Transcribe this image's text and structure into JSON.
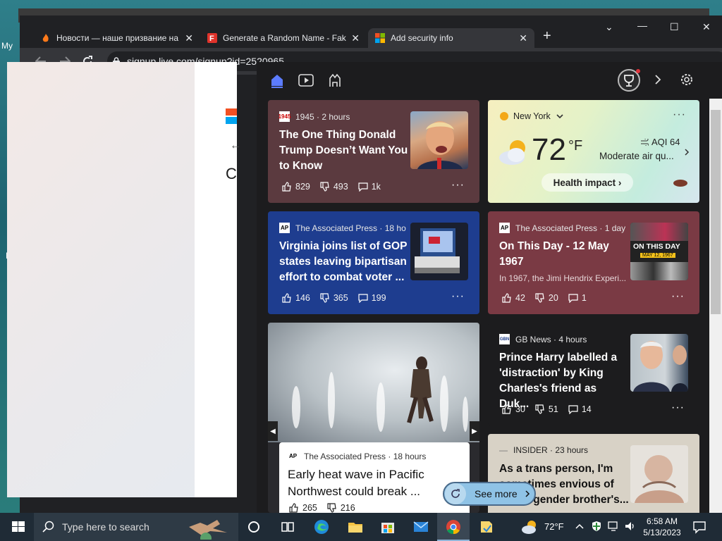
{
  "desktop": {
    "label_top": "My",
    "label_bottom": "N"
  },
  "browser": {
    "tabs": [
      {
        "title": "Новости — наше призвание на",
        "icon": "flame-icon"
      },
      {
        "title": "Generate a Random Name - Fak",
        "icon": "fakename-icon"
      },
      {
        "title": "Add security info",
        "icon": "microsoft-icon"
      }
    ],
    "url": "signup.live.com/signup?id=2520965",
    "colors": {
      "tab_bg": "#202124",
      "active_tab": "#35363a"
    }
  },
  "page": {
    "heading_letter": "C",
    "back_arrow": "←"
  },
  "panel": {
    "nav": [
      "home-icon",
      "video-icon",
      "games-icon"
    ],
    "weather": {
      "location": "New York",
      "temp": "72",
      "unit": "°F",
      "aqi": "AQI 64",
      "air": "Moderate air qu...",
      "health": "Health impact"
    },
    "cards": [
      {
        "source": "1945 · 2 hours",
        "logo": "1945",
        "title": "The One Thing Donald Trump Doesn’t Want You to Know",
        "likes": "829",
        "dislikes": "493",
        "comments": "1k",
        "color": "#5b3a3f"
      },
      {
        "source": "The Associated Press · 18 ho",
        "logo": "AP",
        "title": "Virginia joins list of GOP states leaving bipartisan effort to combat voter ...",
        "likes": "146",
        "dislikes": "365",
        "comments": "199",
        "color": "#1e3d8f"
      },
      {
        "source": "The Associated Press · 1 day",
        "logo": "AP",
        "title": "On This Day - 12 May 1967",
        "excerpt": "In 1967, the Jimi Hendrix Experi...",
        "likes": "42",
        "dislikes": "20",
        "comments": "1",
        "color": "#7a3a44",
        "thumb_text": "ON THIS DAY",
        "thumb_date": "MAY 12, 1967"
      },
      {
        "source": "The Associated Press · 18 hours",
        "logo": "AP",
        "title": "Early heat wave in Pacific Northwest could break ...",
        "likes": "265",
        "dislikes": "216"
      },
      {
        "source": "GB News · 4 hours",
        "logo": "GBN",
        "title": "Prince Harry labelled a 'distraction' by King Charles's friend as Duk...",
        "likes": "30",
        "dislikes": "51",
        "comments": "14",
        "color": "#1c1c1e"
      },
      {
        "source": "INSIDER · 23 hours",
        "logo": "—",
        "title": "As a trans person, I'm sometimes envious of my cisgender brother's...",
        "color": "#d8d2c6"
      }
    ],
    "see_more": "See more"
  },
  "taskbar": {
    "search_placeholder": "Type here to search",
    "weather": "72°F",
    "time": "6:58 AM",
    "date": "5/13/2023"
  }
}
